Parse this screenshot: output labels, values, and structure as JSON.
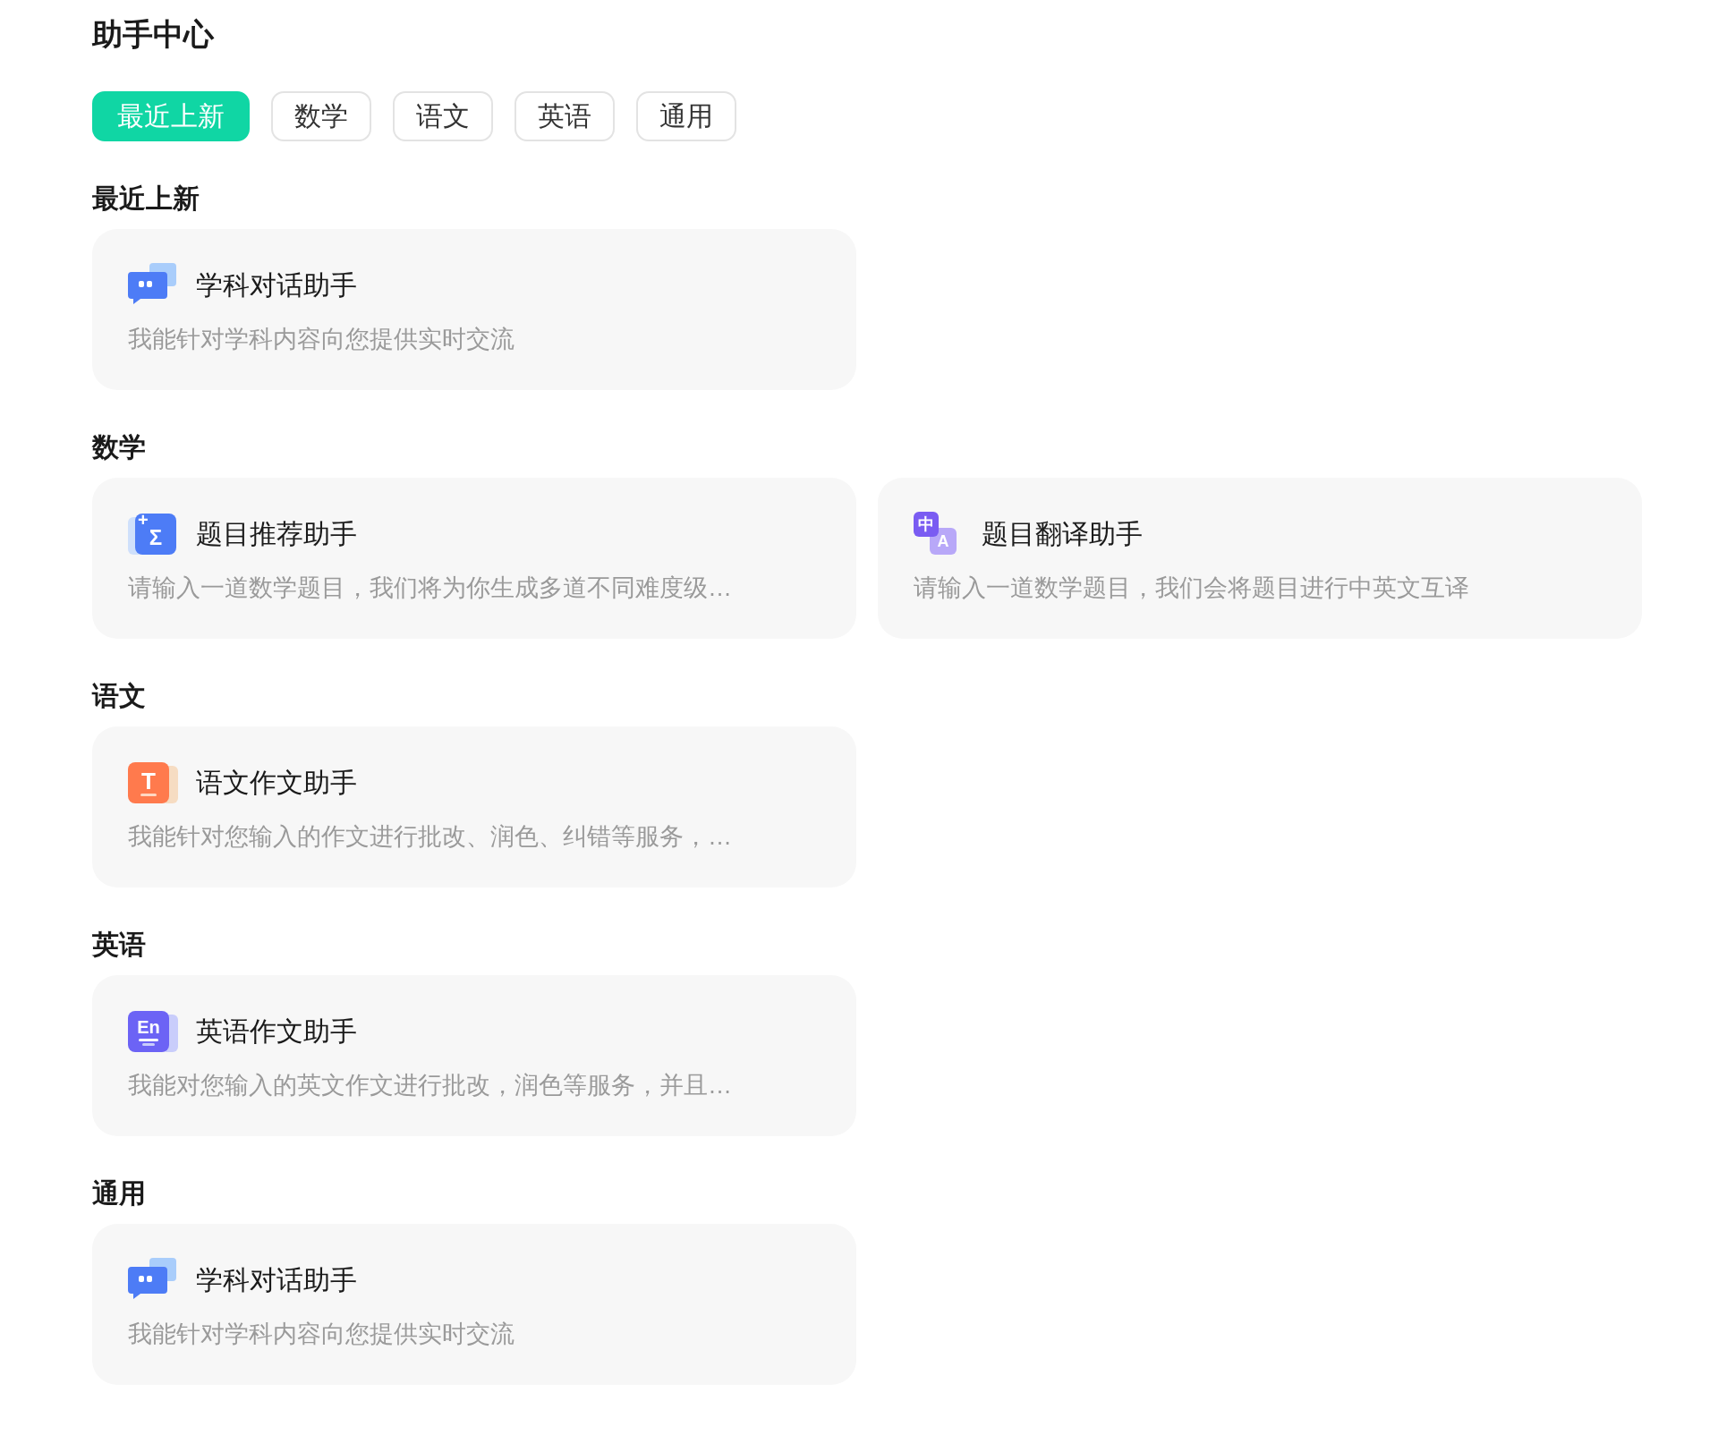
{
  "title": "助手中心",
  "tabs": [
    {
      "label": "最近上新",
      "selected": true
    },
    {
      "label": "数学",
      "selected": false
    },
    {
      "label": "语文",
      "selected": false
    },
    {
      "label": "英语",
      "selected": false
    },
    {
      "label": "通用",
      "selected": false
    }
  ],
  "sections": [
    {
      "heading": "最近上新",
      "cards": [
        {
          "icon": {
            "kind": "chat"
          },
          "title": "学科对话助手",
          "description": "我能针对学科内容向您提供实时交流"
        }
      ]
    },
    {
      "heading": "数学",
      "cards": [
        {
          "icon": {
            "kind": "math",
            "glyphs": [
              "+",
              "Σ"
            ]
          },
          "title": "题目推荐助手",
          "description": "请输入一道数学题目，我们将为你生成多道不同难度级…"
        },
        {
          "icon": {
            "kind": "translate",
            "glyphs": [
              "中",
              "A"
            ]
          },
          "title": "题目翻译助手",
          "description": "请输入一道数学题目，我们会将题目进行中英文互译"
        }
      ]
    },
    {
      "heading": "语文",
      "cards": [
        {
          "icon": {
            "kind": "chinese",
            "glyphs": [
              "T"
            ]
          },
          "title": "语文作文助手",
          "description": "我能针对您输入的作文进行批改、润色、纠错等服务，…"
        }
      ]
    },
    {
      "heading": "英语",
      "cards": [
        {
          "icon": {
            "kind": "english",
            "glyphs": [
              "En"
            ]
          },
          "title": "英语作文助手",
          "description": "我能对您输入的英文作文进行批改，润色等服务，并且…"
        }
      ]
    },
    {
      "heading": "通用",
      "cards": [
        {
          "icon": {
            "kind": "chat"
          },
          "title": "学科对话助手",
          "description": "我能针对学科内容向您提供实时交流"
        }
      ]
    }
  ]
}
